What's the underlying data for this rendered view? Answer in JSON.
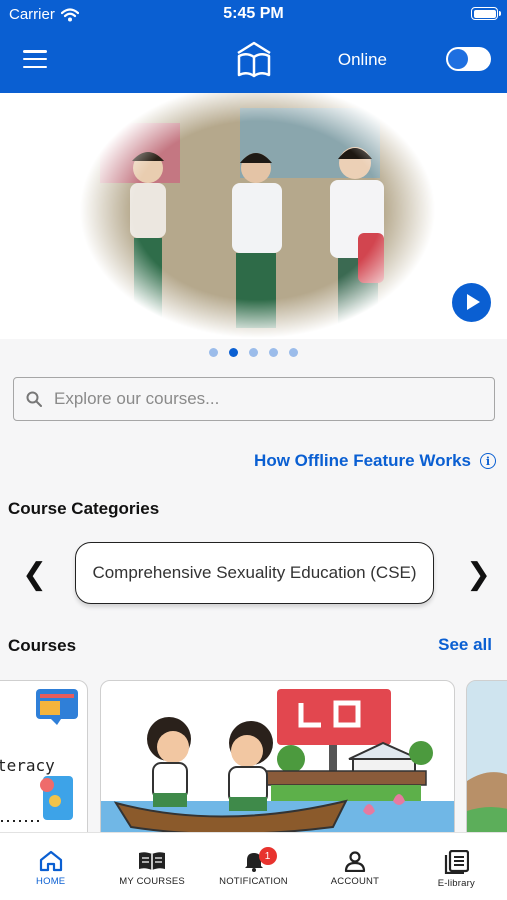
{
  "status_bar": {
    "carrier": "Carrier",
    "time": "5:45 PM"
  },
  "header": {
    "online_label": "Online",
    "online_toggle_on": true
  },
  "hero": {
    "slide_count": 5,
    "active_slide": 1
  },
  "search": {
    "placeholder": "Explore our courses..."
  },
  "offline_link": {
    "label": "How Offline Feature Works"
  },
  "course_categories": {
    "title": "Course Categories",
    "current": "Comprehensive Sexuality Education (CSE)",
    "prev_glyph": "❮",
    "next_glyph": "❯"
  },
  "courses": {
    "title": "Courses",
    "see_all": "See all",
    "card1_text": "teracy"
  },
  "bottom_nav": [
    {
      "label": "HOME",
      "icon": "home-icon"
    },
    {
      "label": "MY COURSES",
      "icon": "book-icon"
    },
    {
      "label": "NOTIFICATION",
      "icon": "bell-icon",
      "badge": "1"
    },
    {
      "label": "ACCOUNT",
      "icon": "person-icon"
    },
    {
      "label": "E-library",
      "icon": "library-icon"
    }
  ],
  "colors": {
    "brand": "#0a5fd2",
    "badge": "#e8332e"
  }
}
